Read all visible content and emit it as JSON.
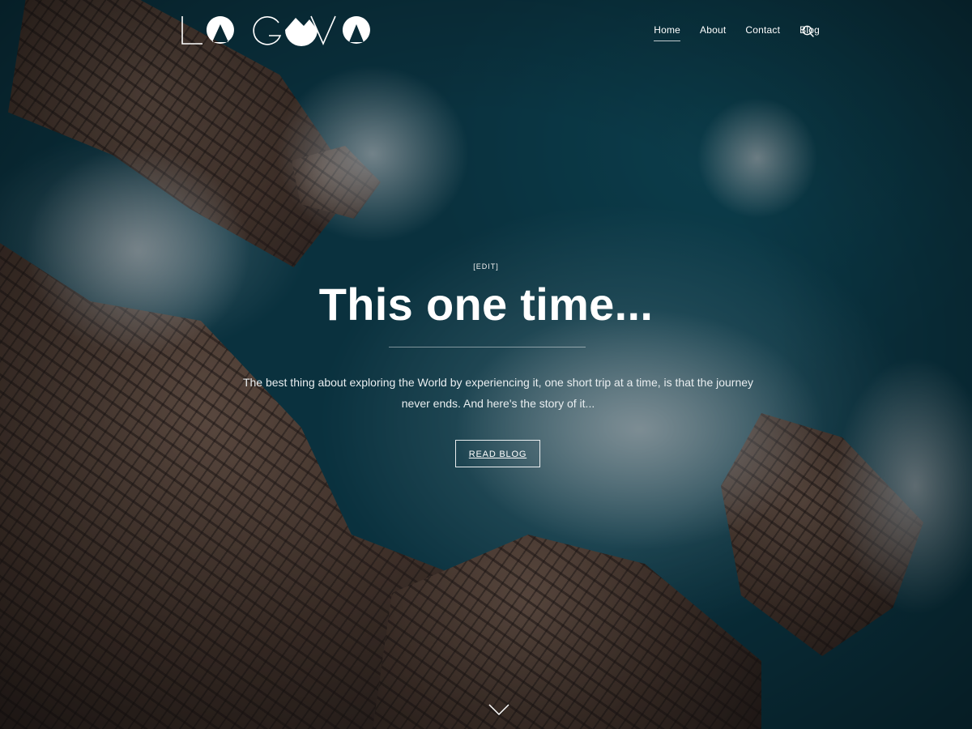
{
  "site": {
    "logo_text": "LOGOVA"
  },
  "nav": {
    "items": [
      {
        "label": "Home",
        "active": true
      },
      {
        "label": "About",
        "active": false
      },
      {
        "label": "Contact",
        "active": false
      },
      {
        "label": "Blog",
        "active": false
      }
    ],
    "search_icon": "search-icon"
  },
  "hero": {
    "edit_label": "[EDIT]",
    "title": "This one time...",
    "description": "The best thing about exploring the World by experiencing it, one short trip at a time, is that the journey never ends. And here's the story of it...",
    "button_label": "READ BLOG",
    "scroll_icon": "chevron-down-icon"
  },
  "colors": {
    "text": "#ffffff",
    "overlay": "rgba(10,16,24,0.38)",
    "ocean": "#0b4c5d",
    "rock": "#5e4332"
  }
}
